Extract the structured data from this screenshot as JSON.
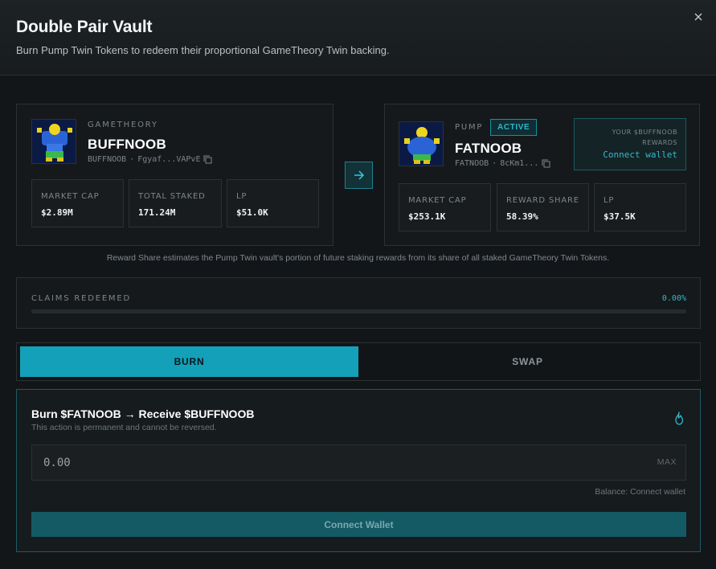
{
  "header": {
    "title": "Double Pair Vault",
    "subtitle": "Burn Pump Twin Tokens to redeem their proportional GameTheory Twin backing."
  },
  "left_token": {
    "category": "GAMETHEORY",
    "name": "BUFFNOOB",
    "ticker": "BUFFNOOB",
    "address": "Fgyaf...VAPvE",
    "stats": [
      {
        "label": "MARKET CAP",
        "value": "$2.89M"
      },
      {
        "label": "TOTAL STAKED",
        "value": "171.24M"
      },
      {
        "label": "LP",
        "value": "$51.0K"
      }
    ]
  },
  "right_token": {
    "category": "PUMP",
    "status": "ACTIVE",
    "name": "FATNOOB",
    "ticker": "FATNOOB",
    "address": "8cKm1...",
    "rewards_label": "YOUR $BUFFNOOB REWARDS",
    "connect_label": "Connect wallet",
    "stats": [
      {
        "label": "MARKET CAP",
        "value": "$253.1K"
      },
      {
        "label": "REWARD SHARE",
        "value": "58.39%"
      },
      {
        "label": "LP",
        "value": "$37.5K"
      }
    ]
  },
  "note": "Reward Share estimates the Pump Twin vault's portion of future staking rewards from its share of all staked GameTheory Twin Tokens.",
  "claims": {
    "label": "CLAIMS REDEEMED",
    "percent_text": "0.00%",
    "progress_fraction": 0
  },
  "tabs": [
    {
      "label": "BURN",
      "active": true
    },
    {
      "label": "SWAP",
      "active": false
    }
  ],
  "burn": {
    "title": "Burn $FATNOOB → Receive $BUFFNOOB",
    "subtitle": "This action is permanent and cannot be reversed.",
    "amount_placeholder": "0.00",
    "max_label": "MAX",
    "balance_text": "Balance: Connect wallet",
    "button_label": "Connect Wallet"
  },
  "colors": {
    "accent": "#14a0b8",
    "background": "#131618",
    "panel": "#16191b"
  },
  "icons": {
    "close": "close-icon",
    "copy": "copy-icon",
    "arrow": "arrow-right-icon",
    "flame": "flame-icon"
  }
}
